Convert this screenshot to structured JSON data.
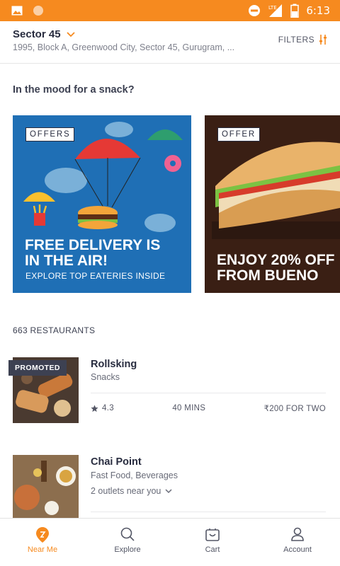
{
  "status_bar": {
    "time": "6:13",
    "network": "LTE"
  },
  "header": {
    "location": "Sector 45",
    "address": "1995, Block A, Greenwood City, Sector 45, Gurugram, ...",
    "filters_label": "FILTERS"
  },
  "snack_heading": "In the mood for a snack?",
  "offers": [
    {
      "tag": "OFFERS",
      "title": "FREE DELIVERY IS\nIN THE AIR!",
      "subtitle": "EXPLORE TOP EATERIES INSIDE"
    },
    {
      "tag": "OFFER",
      "title": "ENJOY 20% OFF\nFROM BUENO"
    }
  ],
  "restaurant_count": "663 RESTAURANTS",
  "restaurants": [
    {
      "badge": "PROMOTED",
      "name": "Rollsking",
      "cuisine": "Snacks",
      "rating": "4.3",
      "time": "40 MINS",
      "cost": "₹200 FOR TWO"
    },
    {
      "name": "Chai Point",
      "cuisine": "Fast Food, Beverages",
      "outlets": "2 outlets near you"
    }
  ],
  "bottom_nav": [
    {
      "label": "Near Me",
      "icon": "location-pin-icon",
      "active": true
    },
    {
      "label": "Explore",
      "icon": "search-icon"
    },
    {
      "label": "Cart",
      "icon": "cart-icon"
    },
    {
      "label": "Account",
      "icon": "account-icon"
    }
  ],
  "colors": {
    "accent": "#f68a1f",
    "text": "#3d4152",
    "muted": "#7e808c",
    "offer_blue": "#1f6fb5"
  }
}
